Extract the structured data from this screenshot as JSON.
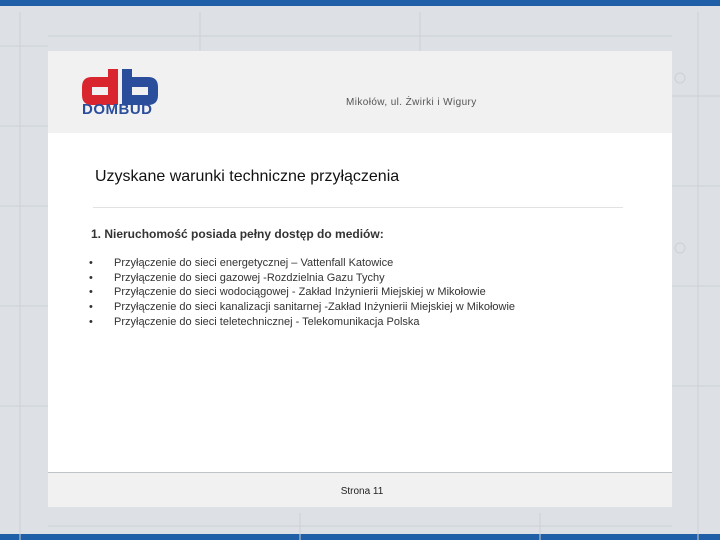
{
  "header": {
    "logo_text": "DOMBUD",
    "address": "Mikołów, ul. Żwirki i Wigury"
  },
  "title": "Uzyskane warunki techniczne przyłączenia",
  "section": {
    "heading": "1. Nieruchomość posiada pełny dostęp do mediów:",
    "items": [
      "Przyłączenie do sieci energetycznej – Vattenfall Katowice",
      "Przyłączenie do sieci gazowej -Rozdzielnia Gazu Tychy",
      "Przyłączenie do sieci wodociągowej - Zakład Inżynierii Miejskiej w Mikołowie",
      "Przyłączenie do sieci kanalizacji sanitarnej -Zakład Inżynierii Miejskiej w Mikołowie",
      "Przyłączenie do sieci teletechnicznej - Telekomunikacja Polska"
    ],
    "bullet_symbol": "•"
  },
  "footer": {
    "page": "Strona 11"
  },
  "colors": {
    "frame_accent": "#1f5fa8",
    "logo_red": "#d9262e",
    "logo_blue": "#2a4d9c"
  }
}
